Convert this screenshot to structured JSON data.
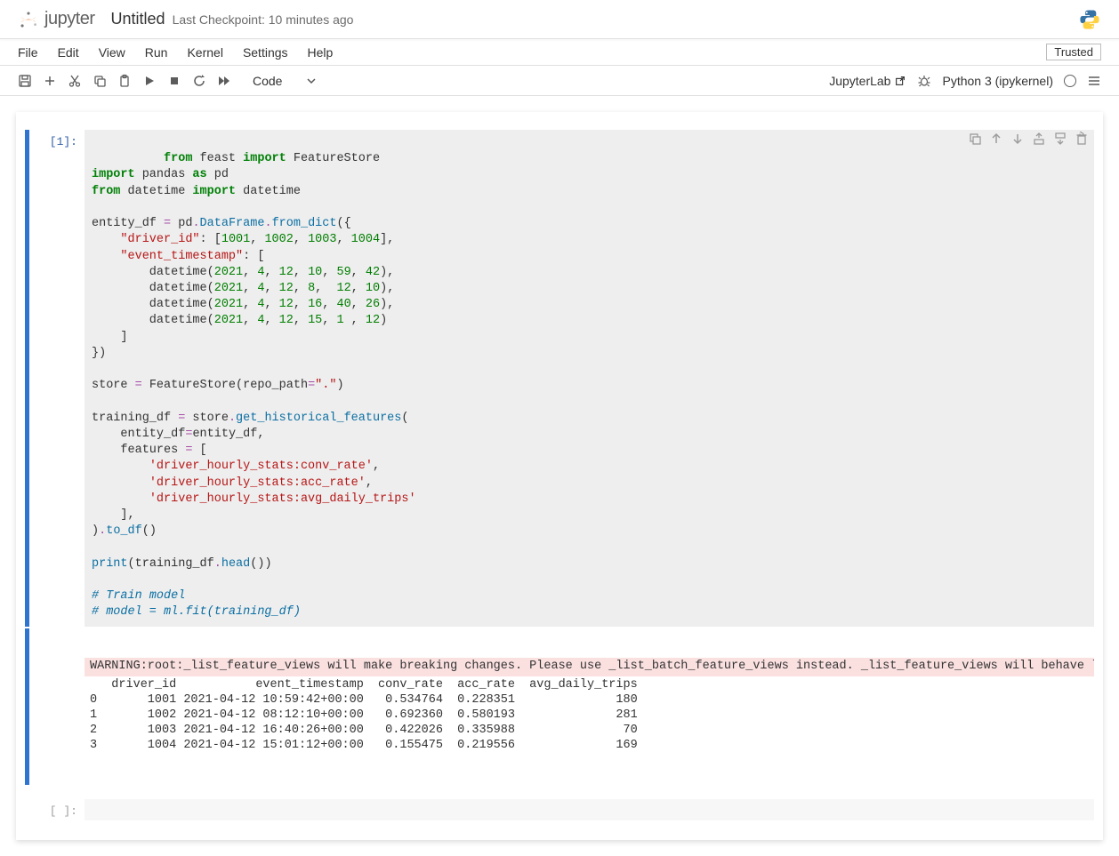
{
  "header": {
    "logo_text": "jupyter",
    "title": "Untitled",
    "checkpoint": "Last Checkpoint: 10 minutes ago"
  },
  "menubar": {
    "items": [
      "File",
      "Edit",
      "View",
      "Run",
      "Kernel",
      "Settings",
      "Help"
    ],
    "trusted": "Trusted"
  },
  "toolbar": {
    "cell_type": "Code",
    "right_link": "JupyterLab",
    "kernel": "Python 3 (ipykernel)"
  },
  "cells": [
    {
      "prompt": "[1]:",
      "code_tokens": [
        [
          "k",
          "from"
        ],
        [
          "",
          " feast "
        ],
        [
          "k",
          "import"
        ],
        [
          "",
          " FeatureStore\n"
        ],
        [
          "k",
          "import"
        ],
        [
          "",
          " pandas "
        ],
        [
          "k",
          "as"
        ],
        [
          "",
          " pd\n"
        ],
        [
          "k",
          "from"
        ],
        [
          "",
          " datetime "
        ],
        [
          "k",
          "import"
        ],
        [
          "",
          " datetime\n\n"
        ],
        [
          "",
          "entity_df "
        ],
        [
          "op",
          "="
        ],
        [
          "",
          " pd"
        ],
        [
          "op",
          "."
        ],
        [
          "fn",
          "DataFrame"
        ],
        [
          "op",
          "."
        ],
        [
          "fn",
          "from_dict"
        ],
        [
          "",
          "({\n    "
        ],
        [
          "s",
          "\"driver_id\""
        ],
        [
          "",
          ": ["
        ],
        [
          "n",
          "1001"
        ],
        [
          "",
          ", "
        ],
        [
          "n",
          "1002"
        ],
        [
          "",
          ", "
        ],
        [
          "n",
          "1003"
        ],
        [
          "",
          ", "
        ],
        [
          "n",
          "1004"
        ],
        [
          "",
          "],\n    "
        ],
        [
          "s",
          "\"event_timestamp\""
        ],
        [
          "",
          ": [\n        datetime("
        ],
        [
          "n",
          "2021"
        ],
        [
          "",
          ", "
        ],
        [
          "n",
          "4"
        ],
        [
          "",
          ", "
        ],
        [
          "n",
          "12"
        ],
        [
          "",
          ", "
        ],
        [
          "n",
          "10"
        ],
        [
          "",
          ", "
        ],
        [
          "n",
          "59"
        ],
        [
          "",
          ", "
        ],
        [
          "n",
          "42"
        ],
        [
          "",
          "),\n        datetime("
        ],
        [
          "n",
          "2021"
        ],
        [
          "",
          ", "
        ],
        [
          "n",
          "4"
        ],
        [
          "",
          ", "
        ],
        [
          "n",
          "12"
        ],
        [
          "",
          ", "
        ],
        [
          "n",
          "8"
        ],
        [
          "",
          ",  "
        ],
        [
          "n",
          "12"
        ],
        [
          "",
          ", "
        ],
        [
          "n",
          "10"
        ],
        [
          "",
          "),\n        datetime("
        ],
        [
          "n",
          "2021"
        ],
        [
          "",
          ", "
        ],
        [
          "n",
          "4"
        ],
        [
          "",
          ", "
        ],
        [
          "n",
          "12"
        ],
        [
          "",
          ", "
        ],
        [
          "n",
          "16"
        ],
        [
          "",
          ", "
        ],
        [
          "n",
          "40"
        ],
        [
          "",
          ", "
        ],
        [
          "n",
          "26"
        ],
        [
          "",
          "),\n        datetime("
        ],
        [
          "n",
          "2021"
        ],
        [
          "",
          ", "
        ],
        [
          "n",
          "4"
        ],
        [
          "",
          ", "
        ],
        [
          "n",
          "12"
        ],
        [
          "",
          ", "
        ],
        [
          "n",
          "15"
        ],
        [
          "",
          ", "
        ],
        [
          "n",
          "1"
        ],
        [
          "",
          " , "
        ],
        [
          "n",
          "12"
        ],
        [
          "",
          ")\n    ]\n})\n\nstore "
        ],
        [
          "op",
          "="
        ],
        [
          "",
          " FeatureStore(repo_path"
        ],
        [
          "op",
          "="
        ],
        [
          "s",
          "\".\""
        ],
        [
          "",
          ")\n\ntraining_df "
        ],
        [
          "op",
          "="
        ],
        [
          "",
          " store"
        ],
        [
          "op",
          "."
        ],
        [
          "fn",
          "get_historical_features"
        ],
        [
          "",
          "(\n    entity_df"
        ],
        [
          "op",
          "="
        ],
        [
          "",
          "entity_df,\n    features "
        ],
        [
          "op",
          "="
        ],
        [
          "",
          " [\n        "
        ],
        [
          "s",
          "'driver_hourly_stats:conv_rate'"
        ],
        [
          "",
          ",\n        "
        ],
        [
          "s",
          "'driver_hourly_stats:acc_rate'"
        ],
        [
          "",
          ",\n        "
        ],
        [
          "s",
          "'driver_hourly_stats:avg_daily_trips'"
        ],
        [
          "",
          "\n    ],\n)"
        ],
        [
          "op",
          "."
        ],
        [
          "fn",
          "to_df"
        ],
        [
          "",
          "()\n\n"
        ],
        [
          "fn",
          "print"
        ],
        [
          "",
          "(training_df"
        ],
        [
          "op",
          "."
        ],
        [
          "fn",
          "head"
        ],
        [
          "",
          "())\n\n"
        ],
        [
          "cmt",
          "# Train model"
        ],
        [
          "",
          "\n"
        ],
        [
          "cmt",
          "# model = ml.fit(training_df)"
        ]
      ],
      "output_warning": "WARNING:root:_list_feature_views will make breaking changes. Please use _list_batch_feature_views instead. _list_feature_views will behave like _list_all_feature_views in the future.",
      "output_text": "   driver_id           event_timestamp  conv_rate  acc_rate  avg_daily_trips\n0       1001 2021-04-12 10:59:42+00:00   0.534764  0.228351              180\n1       1002 2021-04-12 08:12:10+00:00   0.692360  0.580193              281\n2       1003 2021-04-12 16:40:26+00:00   0.422026  0.335988               70\n3       1004 2021-04-12 15:01:12+00:00   0.155475  0.219556              169"
    },
    {
      "prompt": "[ ]:"
    }
  ],
  "chart_data": {
    "type": "table",
    "title": "training_df.head()",
    "columns": [
      "driver_id",
      "event_timestamp",
      "conv_rate",
      "acc_rate",
      "avg_daily_trips"
    ],
    "rows": [
      {
        "index": 0,
        "driver_id": 1001,
        "event_timestamp": "2021-04-12 10:59:42+00:00",
        "conv_rate": 0.534764,
        "acc_rate": 0.228351,
        "avg_daily_trips": 180
      },
      {
        "index": 1,
        "driver_id": 1002,
        "event_timestamp": "2021-04-12 08:12:10+00:00",
        "conv_rate": 0.69236,
        "acc_rate": 0.580193,
        "avg_daily_trips": 281
      },
      {
        "index": 2,
        "driver_id": 1003,
        "event_timestamp": "2021-04-12 16:40:26+00:00",
        "conv_rate": 0.422026,
        "acc_rate": 0.335988,
        "avg_daily_trips": 70
      },
      {
        "index": 3,
        "driver_id": 1004,
        "event_timestamp": "2021-04-12 15:01:12+00:00",
        "conv_rate": 0.155475,
        "acc_rate": 0.219556,
        "avg_daily_trips": 169
      }
    ]
  }
}
